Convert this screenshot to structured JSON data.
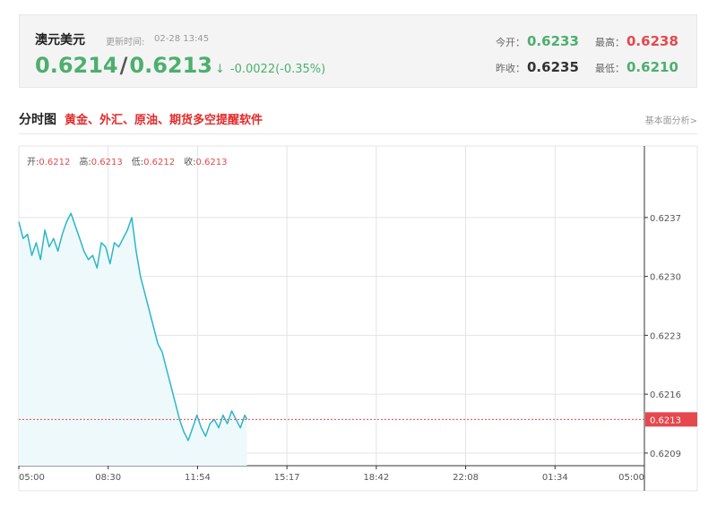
{
  "quote": {
    "instrument": "澳元美元",
    "update_label": "更新时间:",
    "update_time": "02-28 13:45",
    "bid": "0.6214",
    "separator": "/",
    "ask": "0.6213",
    "arrow": "↓",
    "change": "-0.0022(-0.35%)",
    "open_label": "今开：",
    "open_value": "0.6233",
    "high_label": "最高：",
    "high_value": "0.6238",
    "prev_close_label": "昨收：",
    "prev_close_value": "0.6235",
    "low_label": "最低：",
    "low_value": "0.6210"
  },
  "section": {
    "title": "分时图",
    "subtitle": "黄金、外汇、原油、期货多空提醒软件",
    "link": "基本面分析>"
  },
  "ohlc": {
    "open_label": "开:",
    "open": "0.6212",
    "high_label": "高:",
    "high": "0.6213",
    "low_label": "低:",
    "low": "0.6212",
    "close_label": "收:",
    "close": "0.6213"
  },
  "colors": {
    "line": "#2bb6c9",
    "fill": "#eef9fb",
    "grid": "#e3e3e3",
    "current_price": "#e5484d",
    "green": "#4caf6e"
  },
  "chart_data": {
    "type": "line",
    "title": "",
    "xlabel": "",
    "ylabel": "",
    "x_ticks": [
      "05:00",
      "08:30",
      "11:54",
      "15:17",
      "18:42",
      "22:08",
      "01:34",
      "05:00"
    ],
    "y_ticks": [
      0.6237,
      0.623,
      0.6223,
      0.6216,
      0.6209
    ],
    "y_tick_labels": [
      "0.6237",
      "0.6230",
      "0.6223",
      "0.6216",
      "0.6209"
    ],
    "ylim": [
      0.62075,
      0.62455
    ],
    "current_price": 0.6213,
    "current_price_label": "0.6213",
    "grid": true,
    "series": [
      {
        "x": [
          "05:00",
          "05:10",
          "05:20",
          "05:30",
          "05:40",
          "05:50",
          "06:00",
          "06:10",
          "06:20",
          "06:30",
          "06:40",
          "06:50",
          "07:00",
          "07:10",
          "07:20",
          "07:30",
          "07:40",
          "07:50",
          "08:00",
          "08:10",
          "08:20",
          "08:30",
          "08:40",
          "08:50",
          "09:00",
          "09:10",
          "09:20",
          "09:30",
          "09:40",
          "09:50",
          "10:00",
          "10:10",
          "10:20",
          "10:30",
          "10:40",
          "10:50",
          "11:00",
          "11:10",
          "11:20",
          "11:30",
          "11:40",
          "11:50",
          "12:00",
          "12:10",
          "12:20",
          "12:30",
          "12:40",
          "12:50",
          "13:00",
          "13:10",
          "13:20",
          "13:30",
          "13:40",
          "13:45"
        ],
        "values": [
          0.62365,
          0.62345,
          0.6235,
          0.62325,
          0.6234,
          0.6232,
          0.62355,
          0.62335,
          0.62345,
          0.6233,
          0.6235,
          0.62365,
          0.62375,
          0.6236,
          0.62345,
          0.6233,
          0.6232,
          0.62325,
          0.6231,
          0.6234,
          0.62335,
          0.62315,
          0.6234,
          0.62335,
          0.62345,
          0.62355,
          0.6237,
          0.6233,
          0.623,
          0.6228,
          0.6226,
          0.6224,
          0.6222,
          0.6221,
          0.6219,
          0.6217,
          0.6215,
          0.6213,
          0.62115,
          0.62105,
          0.6212,
          0.62135,
          0.6212,
          0.6211,
          0.62125,
          0.6213,
          0.6212,
          0.62135,
          0.62125,
          0.6214,
          0.6213,
          0.6212,
          0.62135,
          0.6213
        ]
      }
    ]
  }
}
